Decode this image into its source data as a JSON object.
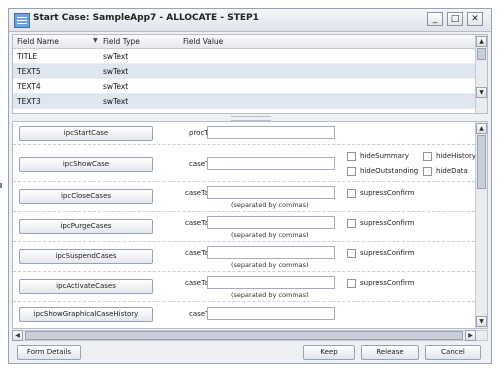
{
  "window": {
    "title": "Start Case: SampleApp7 - ALLOCATE - STEP1",
    "controls": {
      "minimize": "_",
      "maximize": "□",
      "close": "✕"
    }
  },
  "grid": {
    "columns": [
      "Field Name",
      "Field Type",
      "Field Value"
    ],
    "sort_indicator": "▼",
    "rows": [
      {
        "name": "TITLE",
        "type": "swText",
        "value": ""
      },
      {
        "name": "TEXT5",
        "type": "swText",
        "value": ""
      },
      {
        "name": "TEXT4",
        "type": "swText",
        "value": ""
      },
      {
        "name": "TEXT3",
        "type": "swText",
        "value": ""
      }
    ]
  },
  "actions": [
    {
      "button": "ipcStartCase",
      "field_label": "procTag",
      "hint": "",
      "options": []
    },
    {
      "button": "ipcShowCase",
      "field_label": "caseTag",
      "hint": "",
      "options": [
        "hideSummary",
        "hideHistory",
        "hideOutstanding",
        "hideData"
      ]
    },
    {
      "button": "ipcCloseCases",
      "field_label": "caseTags",
      "hint": "(separated by commas)",
      "options": [
        "supressConfirm"
      ]
    },
    {
      "button": "ipcPurgeCases",
      "field_label": "caseTags",
      "hint": "(separated by commas)",
      "options": [
        "supressConfirm"
      ]
    },
    {
      "button": "ipcSuspendCases",
      "field_label": "caseTags",
      "hint": "(separated by commas)",
      "options": [
        "supressConfirm"
      ]
    },
    {
      "button": "ipcActivateCases",
      "field_label": "caseTags",
      "hint": "(separated by commas)",
      "options": [
        "supressConfirm"
      ]
    },
    {
      "button": "ipcShowGraphicalCaseHistory",
      "field_label": "caseTag",
      "hint": "",
      "options": []
    }
  ],
  "scroll_glyphs": {
    "up": "▲",
    "down": "▼",
    "left": "◀",
    "right": "▶"
  },
  "footer": {
    "form_details": "Form Details",
    "keep": "Keep",
    "release": "Release",
    "cancel": "Cancel"
  }
}
